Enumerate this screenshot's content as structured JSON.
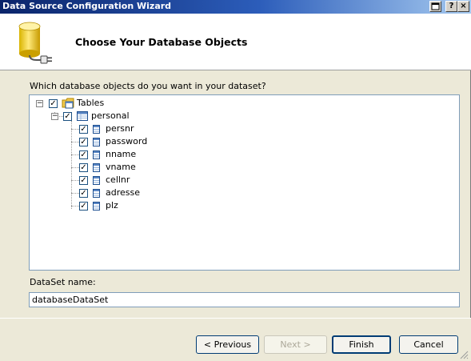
{
  "window": {
    "title": "Data Source Configuration Wizard"
  },
  "header": {
    "title": "Choose Your Database Objects"
  },
  "prompt": "Which database objects do you want in your dataset?",
  "tree": {
    "root": {
      "label": "Tables",
      "checked": true,
      "expanded": true
    },
    "table": {
      "label": "personal",
      "checked": true,
      "expanded": true
    },
    "columns": [
      {
        "label": "persnr",
        "checked": true
      },
      {
        "label": "password",
        "checked": true
      },
      {
        "label": "nname",
        "checked": true
      },
      {
        "label": "vname",
        "checked": true
      },
      {
        "label": "cellnr",
        "checked": true
      },
      {
        "label": "adresse",
        "checked": true
      },
      {
        "label": "plz",
        "checked": true
      }
    ]
  },
  "dataset": {
    "label": "DataSet name:",
    "value": "databaseDataSet"
  },
  "buttons": {
    "previous": "< Previous",
    "next": "Next >",
    "finish": "Finish",
    "cancel": "Cancel"
  },
  "icons": {
    "titlebar_left": "window-icon",
    "titlebar_help": "?",
    "titlebar_close": "×",
    "header": "database-plug-icon",
    "tables": "tables-folder-icon",
    "table": "table-icon",
    "column": "column-icon"
  },
  "colors": {
    "titlebar_start": "#0a246a",
    "titlebar_end": "#a6caf0",
    "dialog_bg": "#ece9d8",
    "input_border": "#7f9db9"
  }
}
